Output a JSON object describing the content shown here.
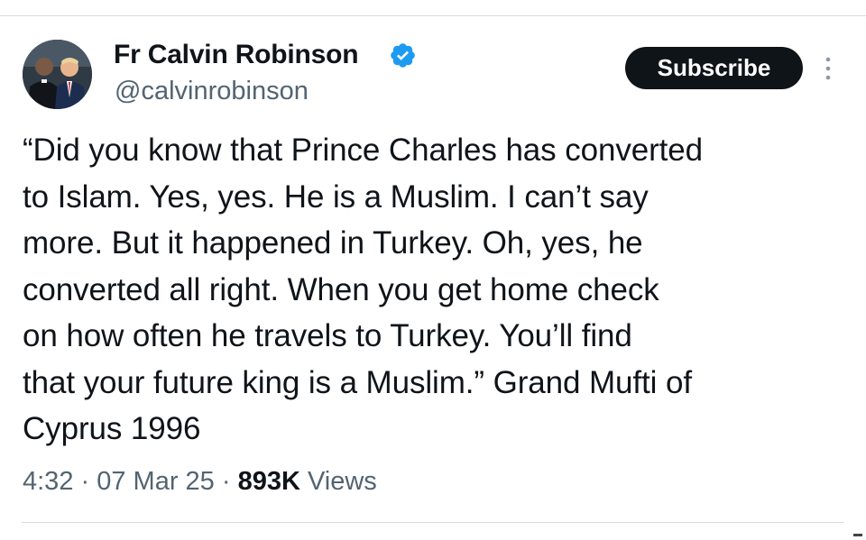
{
  "author": {
    "name": "Fr Calvin Robinson",
    "handle": "@calvinrobinson",
    "verified_color": "#1d9bf0"
  },
  "actions": {
    "subscribe_label": "Subscribe",
    "more_icon": "more-vertical-icon"
  },
  "tweet": {
    "lines": [
      "“Did you know that Prince Charles has converted",
      "to Islam. Yes, yes. He is a Muslim. I can’t say",
      "more. But it happened in Turkey. Oh, yes, he",
      "converted all right. When you get home check",
      "on how often he travels to Turkey. You’ll find",
      "that your future king is a Muslim.” Grand Mufti of",
      "Cyprus 1996"
    ]
  },
  "meta": {
    "time": "4:32",
    "sep1": " · ",
    "date": "07 Mar 25",
    "sep2": " · ",
    "views_count": "893K",
    "views_label": " Views"
  },
  "colors": {
    "text": "#0f1419",
    "secondary_text": "#536471",
    "divider": "#d9dcdf",
    "button_bg": "#0f1419"
  }
}
